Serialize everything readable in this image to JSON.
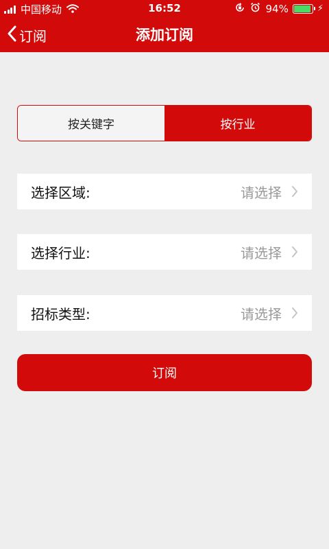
{
  "status_bar": {
    "carrier": "中国移动",
    "time": "16:52",
    "battery_percent_text": "94%",
    "battery_level": 0.94,
    "signal_bars": 4
  },
  "nav": {
    "back_label": "订阅",
    "title": "添加订阅"
  },
  "segment": {
    "options": [
      {
        "label": "按关键字",
        "selected": false
      },
      {
        "label": "按行业",
        "selected": true
      }
    ]
  },
  "form": {
    "rows": [
      {
        "label": "选择区域:",
        "value": "请选择"
      },
      {
        "label": "选择行业:",
        "value": "请选择"
      },
      {
        "label": "招标类型:",
        "value": "请选择"
      }
    ]
  },
  "submit_label": "订阅",
  "colors": {
    "brand_red": "#d20a0a",
    "background": "#eeeeee",
    "placeholder_gray": "#999999",
    "battery_green": "#4cd964"
  }
}
